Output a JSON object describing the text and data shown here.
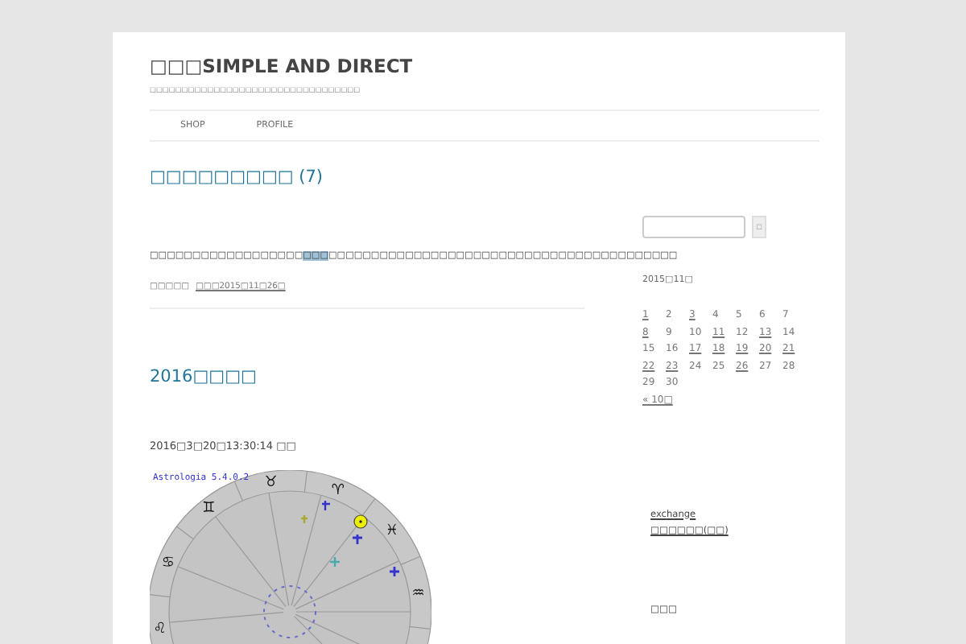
{
  "site": {
    "title": "□□□SIMPLE AND DIRECT",
    "tagline": "□□□□□□□□□□□□□□□□□□□□□□□□□□□□□□□□□"
  },
  "nav": [
    {
      "label": "SHOP"
    },
    {
      "label": "PROFILE"
    }
  ],
  "posts": [
    {
      "title": "□□□□□□□□□ (7)",
      "paragraph": {
        "before": "□□□□□□□□□□□□□□□□□□",
        "link": "□□□",
        "after": "□□□□□□□□□□□□□□□□□□□□□□□□□□□□□□□□□□□□□□□□□"
      },
      "meta_label": "□□□□□",
      "meta_date": "□□□2015□11□26□"
    },
    {
      "title": "2016□□□□",
      "date_line": "2016□3□20□13:30:14 □□",
      "chart_image": {
        "label": "Astrologia 5.4.0.2",
        "signs": [
          "♒",
          "♓",
          "♈",
          "♉",
          "♊",
          "♋",
          "♌"
        ]
      }
    }
  ],
  "sidebar": {
    "search": {
      "button": "□"
    },
    "calendar": {
      "caption": "2015□11□",
      "weeks": [
        [
          {
            "day": "1",
            "linked": true
          },
          {
            "day": "2",
            "linked": false
          },
          {
            "day": "3",
            "linked": true
          },
          {
            "day": "4",
            "linked": false
          },
          {
            "day": "5",
            "linked": false
          },
          {
            "day": "6",
            "linked": false
          },
          {
            "day": "7",
            "linked": false
          }
        ],
        [
          {
            "day": "8",
            "linked": true
          },
          {
            "day": "9",
            "linked": false
          },
          {
            "day": "10",
            "linked": false
          },
          {
            "day": "11",
            "linked": true
          },
          {
            "day": "12",
            "linked": false
          },
          {
            "day": "13",
            "linked": true
          },
          {
            "day": "14",
            "linked": false
          }
        ],
        [
          {
            "day": "15",
            "linked": false
          },
          {
            "day": "16",
            "linked": false
          },
          {
            "day": "17",
            "linked": true
          },
          {
            "day": "18",
            "linked": true
          },
          {
            "day": "19",
            "linked": true
          },
          {
            "day": "20",
            "linked": true
          },
          {
            "day": "21",
            "linked": true
          }
        ],
        [
          {
            "day": "22",
            "linked": true
          },
          {
            "day": "23",
            "linked": true
          },
          {
            "day": "24",
            "linked": false
          },
          {
            "day": "25",
            "linked": false
          },
          {
            "day": "26",
            "linked": true
          },
          {
            "day": "27",
            "linked": false
          },
          {
            "day": "28",
            "linked": false
          }
        ],
        [
          {
            "day": "29",
            "linked": false
          },
          {
            "day": "30",
            "linked": false
          }
        ]
      ],
      "prev": "« 10□"
    },
    "links": [
      "exchange",
      "□□□□□□(□□)"
    ],
    "footer_heading": "□□□"
  }
}
